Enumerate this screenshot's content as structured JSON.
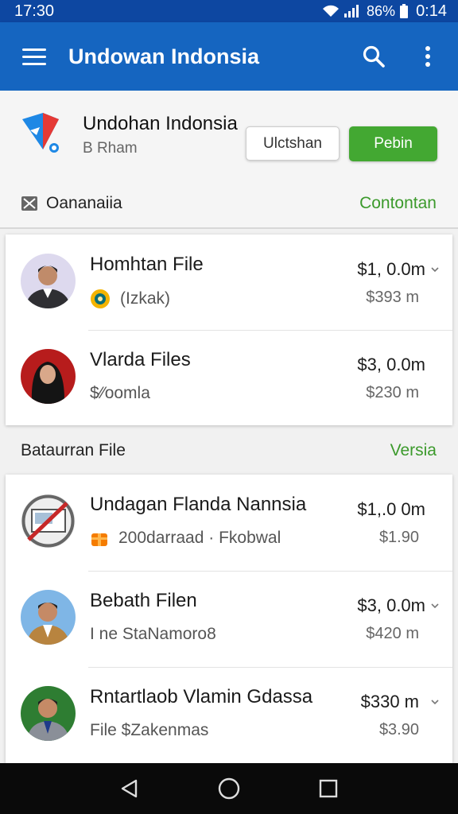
{
  "status_bar": {
    "time": "17:30",
    "battery": "86%",
    "clock_right": "0:14"
  },
  "app_bar": {
    "title": "Undowan Indonsia",
    "icons": [
      "menu-icon",
      "search-icon",
      "more-vert-icon"
    ]
  },
  "profile": {
    "name": "Undohan Indonsia",
    "subtitle": "B Rham",
    "outline_button": "Ulctshan",
    "primary_button": "Pebin"
  },
  "section1": {
    "title": "Oananaiia",
    "action": "Contontan"
  },
  "list1": [
    {
      "title": "Homhtan File",
      "subtitle": "(Izkak)",
      "price": "$1, 0.0m",
      "price_sub": "$393 m"
    },
    {
      "title": "Vlarda Files",
      "subtitle": "$⁄⁄oomla",
      "price": "$3, 0.0m",
      "price_sub": "$230 m"
    }
  ],
  "section2": {
    "title": "Bataurran File",
    "action": "Versia"
  },
  "list2": [
    {
      "title": "Undagan Flanda Nannsia",
      "subtitle": "200darraad · Fkobwal",
      "price": "$1,.0 0m",
      "price_sub": "$1.90"
    },
    {
      "title": "Bebath Filen",
      "subtitle": "I ne StaNamoro8",
      "price": "$3, 0.0m",
      "price_sub": "$420 m"
    },
    {
      "title": "Rntartlaob Vlamin Gdassa",
      "subtitle": "File $Zakenmas",
      "price": "$330 m",
      "price_sub": "$3.90"
    }
  ],
  "colors": {
    "app_bar": "#1565c0",
    "status_bar": "#0d47a1",
    "accent_green": "#43a832",
    "link_green": "#3c9a2c"
  }
}
